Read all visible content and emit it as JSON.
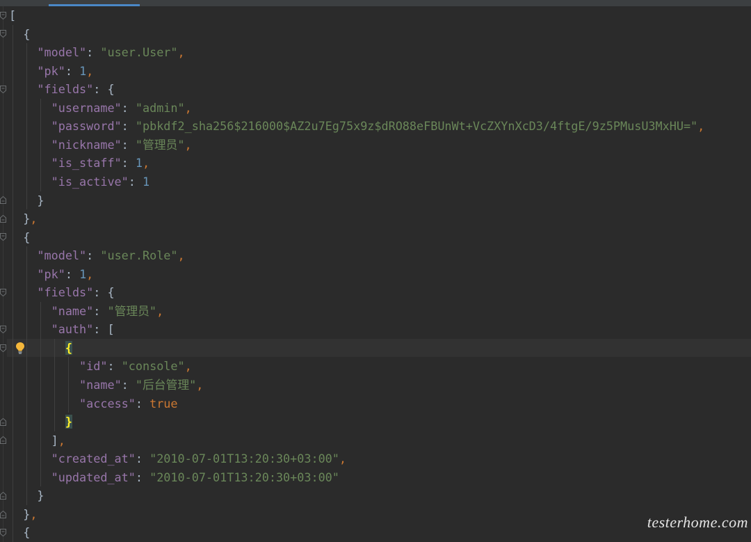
{
  "editor": {
    "colors": {
      "background": "#2b2b2b",
      "tab_bar": "#3c3f41",
      "tab_accent": "#4a88c7",
      "current_line": "#323232",
      "indent_guide": "#3f3f3f",
      "key": "#9876aa",
      "string": "#6a8759",
      "number": "#6897bb",
      "keyword": "#cc7832",
      "punctuation": "#a9b7c6",
      "brace_match": "#ffef28",
      "brace_match_bg": "#3b514d"
    },
    "lines": [
      {
        "tokens": [
          [
            "p",
            "["
          ]
        ],
        "fold_marker": "fold-open-icon"
      },
      {
        "tokens": [
          [
            "ws",
            "  "
          ],
          [
            "p",
            "{"
          ]
        ],
        "fold_marker": "fold-open-icon"
      },
      {
        "tokens": [
          [
            "ws",
            "    "
          ],
          [
            "key",
            "\"model\""
          ],
          [
            "p",
            ": "
          ],
          [
            "str",
            "\"user.User\""
          ],
          [
            "c",
            ","
          ]
        ]
      },
      {
        "tokens": [
          [
            "ws",
            "    "
          ],
          [
            "key",
            "\"pk\""
          ],
          [
            "p",
            ": "
          ],
          [
            "num",
            "1"
          ],
          [
            "c",
            ","
          ]
        ]
      },
      {
        "tokens": [
          [
            "ws",
            "    "
          ],
          [
            "key",
            "\"fields\""
          ],
          [
            "p",
            ": {"
          ]
        ],
        "fold_marker": "fold-open-icon"
      },
      {
        "tokens": [
          [
            "ws",
            "      "
          ],
          [
            "key",
            "\"username\""
          ],
          [
            "p",
            ": "
          ],
          [
            "str",
            "\"admin\""
          ],
          [
            "c",
            ","
          ]
        ]
      },
      {
        "tokens": [
          [
            "ws",
            "      "
          ],
          [
            "key",
            "\"password\""
          ],
          [
            "p",
            ": "
          ],
          [
            "str",
            "\"pbkdf2_sha256$216000$AZ2u7Eg75x9z$dRO88eFBUnWt+VcZXYnXcD3/4ftgE/9z5PMusU3MxHU=\""
          ],
          [
            "c",
            ","
          ]
        ]
      },
      {
        "tokens": [
          [
            "ws",
            "      "
          ],
          [
            "key",
            "\"nickname\""
          ],
          [
            "p",
            ": "
          ],
          [
            "str",
            "\"管理员\""
          ],
          [
            "c",
            ","
          ]
        ]
      },
      {
        "tokens": [
          [
            "ws",
            "      "
          ],
          [
            "key",
            "\"is_staff\""
          ],
          [
            "p",
            ": "
          ],
          [
            "num",
            "1"
          ],
          [
            "c",
            ","
          ]
        ]
      },
      {
        "tokens": [
          [
            "ws",
            "      "
          ],
          [
            "key",
            "\"is_active\""
          ],
          [
            "p",
            ": "
          ],
          [
            "num",
            "1"
          ]
        ]
      },
      {
        "tokens": [
          [
            "ws",
            "    "
          ],
          [
            "p",
            "}"
          ]
        ],
        "fold_marker": "fold-close-icon"
      },
      {
        "tokens": [
          [
            "ws",
            "  "
          ],
          [
            "p",
            "}"
          ],
          [
            "c",
            ","
          ]
        ],
        "fold_marker": "fold-close-icon"
      },
      {
        "tokens": [
          [
            "ws",
            "  "
          ],
          [
            "p",
            "{"
          ]
        ],
        "fold_marker": "fold-open-icon"
      },
      {
        "tokens": [
          [
            "ws",
            "    "
          ],
          [
            "key",
            "\"model\""
          ],
          [
            "p",
            ": "
          ],
          [
            "str",
            "\"user.Role\""
          ],
          [
            "c",
            ","
          ]
        ]
      },
      {
        "tokens": [
          [
            "ws",
            "    "
          ],
          [
            "key",
            "\"pk\""
          ],
          [
            "p",
            ": "
          ],
          [
            "num",
            "1"
          ],
          [
            "c",
            ","
          ]
        ]
      },
      {
        "tokens": [
          [
            "ws",
            "    "
          ],
          [
            "key",
            "\"fields\""
          ],
          [
            "p",
            ": {"
          ]
        ],
        "fold_marker": "fold-open-icon"
      },
      {
        "tokens": [
          [
            "ws",
            "      "
          ],
          [
            "key",
            "\"name\""
          ],
          [
            "p",
            ": "
          ],
          [
            "str",
            "\"管理员\""
          ],
          [
            "c",
            ","
          ]
        ]
      },
      {
        "tokens": [
          [
            "ws",
            "      "
          ],
          [
            "key",
            "\"auth\""
          ],
          [
            "p",
            ": ["
          ]
        ],
        "fold_marker": "fold-open-icon"
      },
      {
        "tokens": [
          [
            "ws",
            "        "
          ],
          [
            "bm",
            "{"
          ]
        ],
        "fold_marker": "fold-open-icon",
        "current": true,
        "gutter_icon": "bulb-icon"
      },
      {
        "tokens": [
          [
            "ws",
            "          "
          ],
          [
            "key",
            "\"id\""
          ],
          [
            "p",
            ": "
          ],
          [
            "str",
            "\"console\""
          ],
          [
            "c",
            ","
          ]
        ]
      },
      {
        "tokens": [
          [
            "ws",
            "          "
          ],
          [
            "key",
            "\"name\""
          ],
          [
            "p",
            ": "
          ],
          [
            "str",
            "\"后台管理\""
          ],
          [
            "c",
            ","
          ]
        ]
      },
      {
        "tokens": [
          [
            "ws",
            "          "
          ],
          [
            "key",
            "\"access\""
          ],
          [
            "p",
            ": "
          ],
          [
            "kw",
            "true"
          ]
        ]
      },
      {
        "tokens": [
          [
            "ws",
            "        "
          ],
          [
            "bm",
            "}"
          ]
        ],
        "fold_marker": "fold-close-icon"
      },
      {
        "tokens": [
          [
            "ws",
            "      "
          ],
          [
            "p",
            "]"
          ],
          [
            "c",
            ","
          ]
        ],
        "fold_marker": "fold-close-icon"
      },
      {
        "tokens": [
          [
            "ws",
            "      "
          ],
          [
            "key",
            "\"created_at\""
          ],
          [
            "p",
            ": "
          ],
          [
            "str",
            "\"2010-07-01T13:20:30+03:00\""
          ],
          [
            "c",
            ","
          ]
        ]
      },
      {
        "tokens": [
          [
            "ws",
            "      "
          ],
          [
            "key",
            "\"updated_at\""
          ],
          [
            "p",
            ": "
          ],
          [
            "str",
            "\"2010-07-01T13:20:30+03:00\""
          ]
        ]
      },
      {
        "tokens": [
          [
            "ws",
            "    "
          ],
          [
            "p",
            "}"
          ]
        ],
        "fold_marker": "fold-close-icon"
      },
      {
        "tokens": [
          [
            "ws",
            "  "
          ],
          [
            "p",
            "}"
          ],
          [
            "c",
            ","
          ]
        ],
        "fold_marker": "fold-close-icon"
      },
      {
        "tokens": [
          [
            "ws",
            "  "
          ],
          [
            "p",
            "{"
          ]
        ],
        "fold_marker": "fold-open-icon"
      }
    ]
  },
  "watermark": "testerhome.com"
}
